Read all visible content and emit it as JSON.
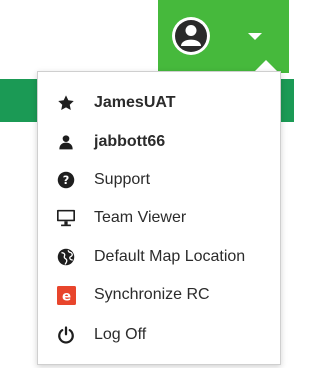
{
  "colors": {
    "header_green": "#46b93c",
    "bar_green": "#1b9a55",
    "text": "#2b2b2b",
    "sync_icon_red": "#e8452c"
  },
  "header": {
    "icons": [
      "user-avatar-icon",
      "chevron-down-icon"
    ]
  },
  "menu": {
    "items": [
      {
        "label": "JamesUAT",
        "icon": "star-icon",
        "bold": true
      },
      {
        "label": "jabbott66",
        "icon": "user-icon",
        "bold": true
      },
      {
        "label": "Support",
        "icon": "question-circle-icon",
        "bold": false
      },
      {
        "label": "Team Viewer",
        "icon": "monitor-icon",
        "bold": false
      },
      {
        "label": "Default Map Location",
        "icon": "globe-icon",
        "bold": false
      },
      {
        "label": "Synchronize RC",
        "icon": "sync-e-icon",
        "bold": false
      },
      {
        "label": "Log Off",
        "icon": "power-icon",
        "bold": false
      }
    ]
  }
}
